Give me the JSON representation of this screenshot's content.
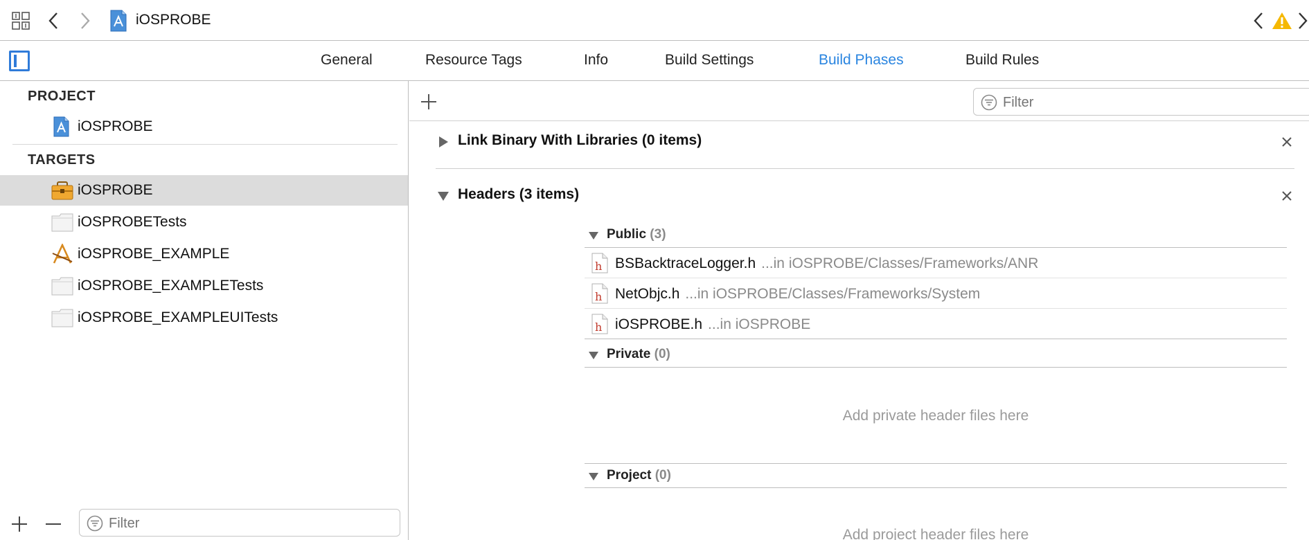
{
  "window": {
    "title": "iOSPROBE"
  },
  "tabs": [
    {
      "label": "General",
      "active": false
    },
    {
      "label": "Resource Tags",
      "active": false
    },
    {
      "label": "Info",
      "active": false
    },
    {
      "label": "Build Settings",
      "active": false
    },
    {
      "label": "Build Phases",
      "active": true
    },
    {
      "label": "Build Rules",
      "active": false
    }
  ],
  "sidebar": {
    "project_header": "PROJECT",
    "project_item": {
      "label": "iOSPROBE",
      "icon": "xcode-project-icon"
    },
    "targets_header": "TARGETS",
    "targets": [
      {
        "label": "iOSPROBE",
        "icon": "framework-toolbox-icon",
        "selected": true
      },
      {
        "label": "iOSPROBETests",
        "icon": "test-bundle-icon",
        "selected": false
      },
      {
        "label": "iOSPROBE_EXAMPLE",
        "icon": "app-target-icon",
        "selected": false
      },
      {
        "label": "iOSPROBE_EXAMPLETests",
        "icon": "test-bundle-icon",
        "selected": false
      },
      {
        "label": "iOSPROBE_EXAMPLEUITests",
        "icon": "test-bundle-icon",
        "selected": false
      }
    ],
    "filter_placeholder": "Filter"
  },
  "main": {
    "filter_placeholder": "Filter",
    "phases": [
      {
        "title": "Link Binary With Libraries (0 items)",
        "expanded": false
      },
      {
        "title": "Headers (3 items)",
        "expanded": true
      }
    ],
    "headers": {
      "public": {
        "label": "Public",
        "count": "(3)"
      },
      "files": [
        {
          "name": "BSBacktraceLogger.h",
          "path": "...in iOSPROBE/Classes/Frameworks/ANR"
        },
        {
          "name": "NetObjc.h",
          "path": "...in iOSPROBE/Classes/Frameworks/System"
        },
        {
          "name": "iOSPROBE.h",
          "path": "...in iOSPROBE"
        }
      ],
      "private": {
        "label": "Private",
        "count": "(0)",
        "placeholder": "Add private header files here"
      },
      "project": {
        "label": "Project",
        "count": "(0)",
        "placeholder": "Add project header files here"
      }
    }
  },
  "colors": {
    "accent": "#2a85e0",
    "warning": "#f5b800",
    "selected_row": "#dcdcdc"
  }
}
